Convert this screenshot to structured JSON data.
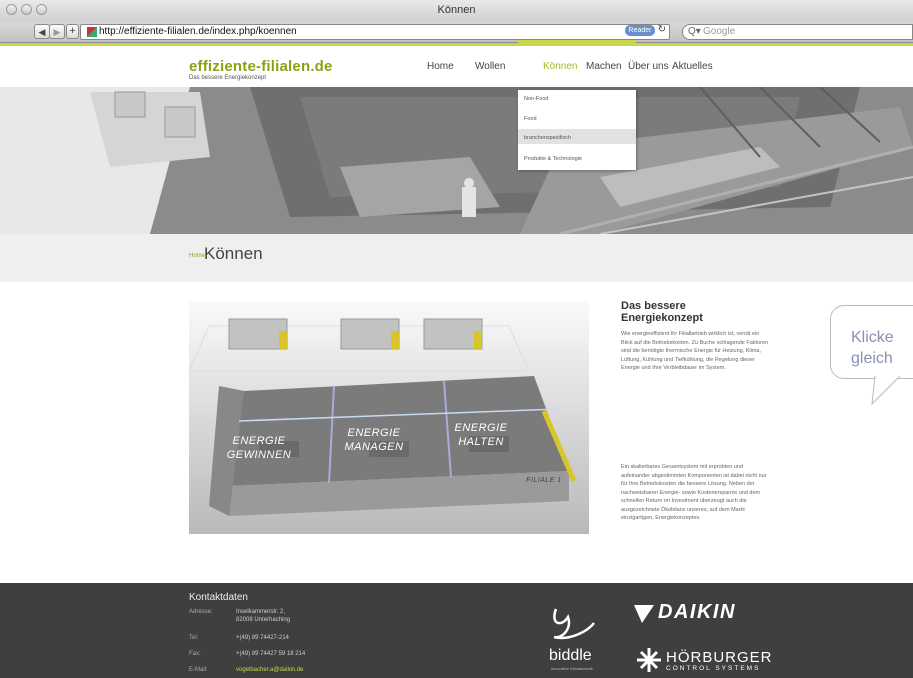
{
  "browser": {
    "window_title": "Können",
    "url": "http://effiziente-filialen.de/index.php/koennen",
    "reader_label": "Reader",
    "search_placeholder": "Google",
    "back_label": "◀",
    "forward_label": "▶",
    "add_label": "+"
  },
  "site": {
    "logo": "effiziente-filialen.de",
    "tagline": "Das bessere Energiekonzept",
    "nav": [
      "Home",
      "Wollen",
      "Können",
      "Machen",
      "Über uns",
      "Aktuelles"
    ],
    "active_nav": "Können",
    "dropdown": [
      "Non-Food",
      "Food",
      "branchenspezifisch",
      "Produkte & Technologie"
    ]
  },
  "page": {
    "breadcrumb": "Home",
    "title": "Können"
  },
  "diagram": {
    "zones": [
      "ENERGIE\nGEWINNEN",
      "ENERGIE\nMANAGEN",
      "ENERGIE\nHALTEN"
    ],
    "floor_label": "FILIALE 1"
  },
  "sidebar": {
    "heading": "Das bessere Energiekonzept",
    "para1": "Wie energieeffizient Ihr Filialbetrieb wirklich ist, verrät ein Blick auf die Betriebskosten. Zu Buche schlagende Faktoren sind die benötigte thermische Energie für Heizung, Klima, Lüftung, Kühlung und Tiefkühlung, die Regelung dieser Energie und Ihre Verbleibdauer im System.",
    "para2": "Ein skalierbares Gesamtsystem mit erprobten und aufeinander abgestimmten Komponenten ist dabei nicht nur für Ihre Betriebskosten die bessere Lösung. Neben der nachweisbaren Energie- sowie Kostenersparnis und dem schnellen Return on Investment überzeugt auch die ausgezeichnete Ökobilanz unseres, auf dem Markt einzigartigen, Energiekonzeptes.",
    "bubble_line1": "Klicke",
    "bubble_line2": "gleich"
  },
  "footer": {
    "heading": "Kontaktdaten",
    "address_label": "Adresse:",
    "address_line1": "Inselkammerstr. 2,",
    "address_line2": "82008 Unterhaching",
    "tel_label": "Tel:",
    "tel": "+(49) 89 74427-214",
    "fax_label": "Fax:",
    "fax": "+(49) 89 74427 59 18 214",
    "email_label": "E-Mail:",
    "email": "vogelbacher.a@daikin.de",
    "logos": {
      "daikin": "DAIKIN",
      "biddle": "biddle",
      "biddle_sub": "innovative Klimatechnik",
      "horburger": "HÖRBURGER",
      "horburger_sub": "CONTROL SYSTEMS"
    }
  },
  "colors": {
    "accent": "#c7d64a",
    "logo_green": "#8f9f14",
    "footer_bg": "#3f3f3f"
  }
}
